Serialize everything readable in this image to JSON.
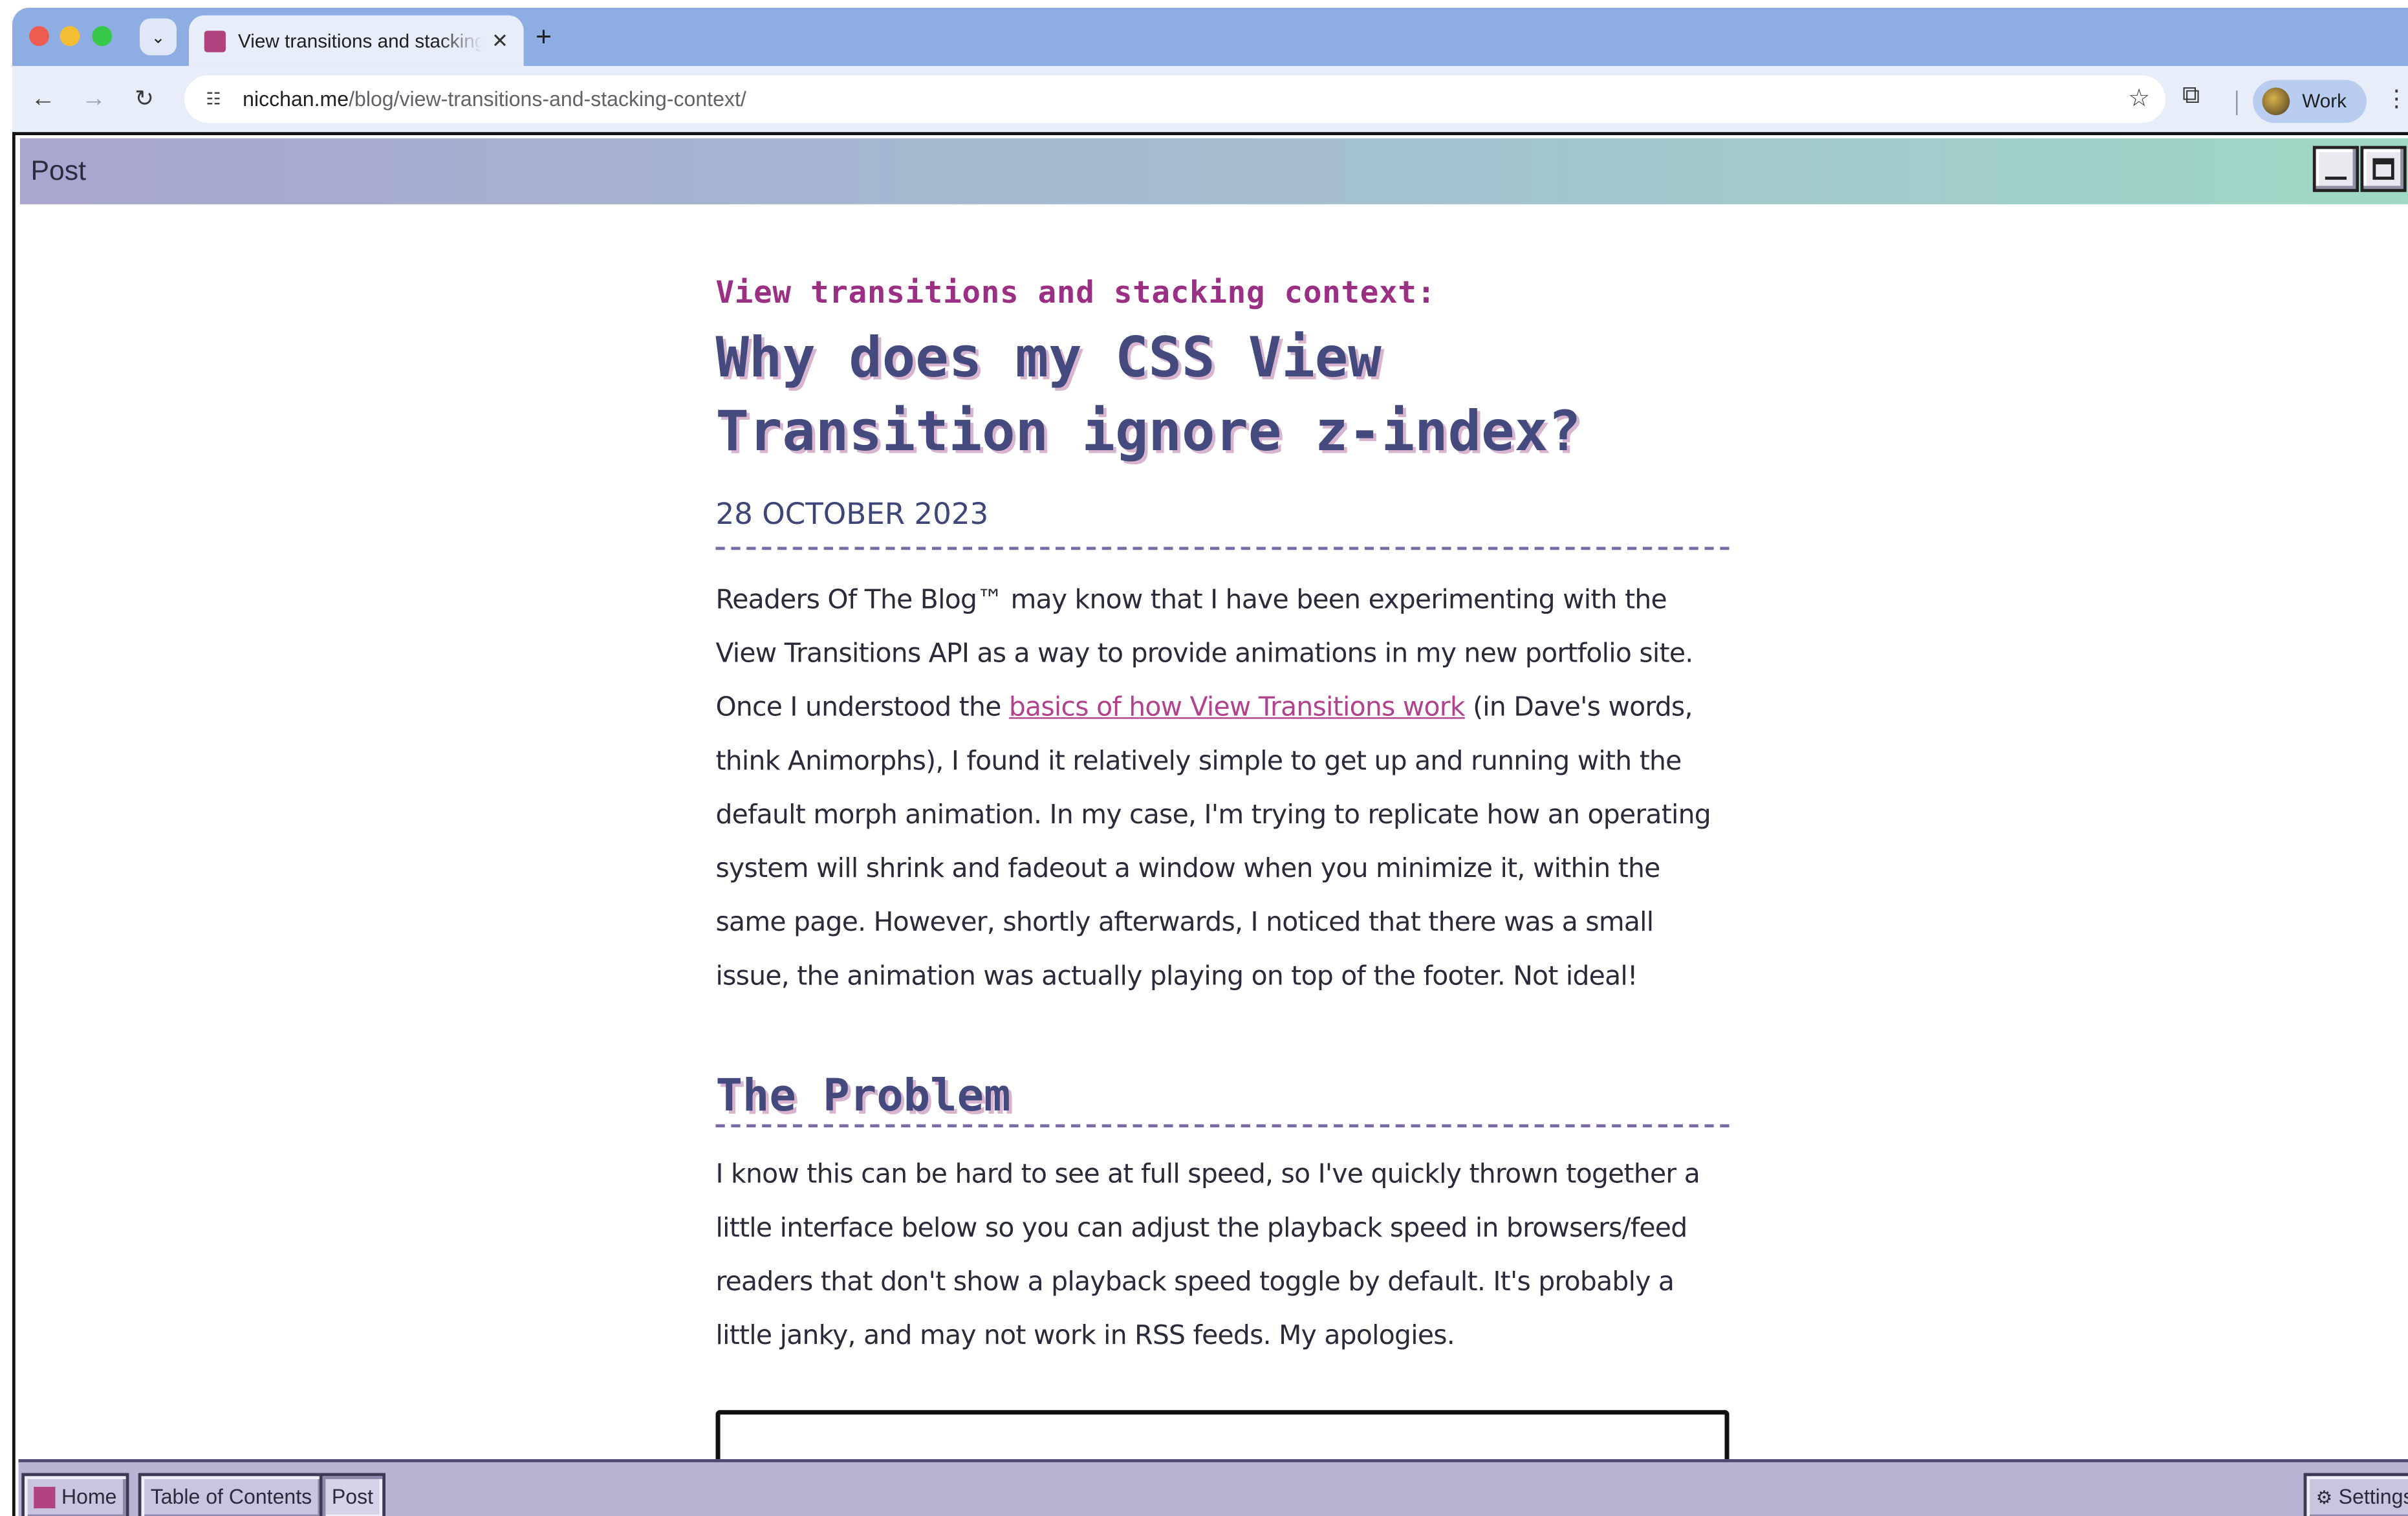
{
  "browser": {
    "tab_title": "View transitions and stacking context",
    "tab_close": "✕",
    "new_tab": "+",
    "url_host": "nicchan.me",
    "url_path": "/blog/view-transitions-and-stacking-context/",
    "profile_label": "Work"
  },
  "window": {
    "title": "Post"
  },
  "article": {
    "kicker": "View transitions and stacking context:",
    "title": "Why does my CSS View Transition ignore z-index?",
    "date": "28 OCTOBER 2023",
    "para1_before": "Readers Of The Blog™ may know that I have been experimenting with the View Transitions API as a way to provide animations in my new portfolio site. Once I understood the ",
    "para1_link": "basics of how View Transitions work",
    "para1_after": " (in Dave's words, think Animorphs), I found it relatively simple to get up and running with the default morph animation. In my case, I'm trying to replicate how an operating system will shrink and fadeout a window when you minimize it, within the same page. However, shortly afterwards, I noticed that there was a small issue, the animation was actually playing on top of the footer. Not ideal!",
    "section_heading": "The Problem",
    "para2": "I know this can be hard to see at full speed, so I've quickly thrown together a little interface below so you can adjust the playback speed in browsers/feed readers that don't show a playback speed toggle by default. It's probably a little janky, and may not work in RSS feeds. My apologies."
  },
  "taskbar": {
    "home_label": "Home",
    "toc_label": "Table of Contents",
    "post_label": "Post",
    "settings_label": "Settings"
  },
  "icons": {
    "back": "back-arrow-icon",
    "forward": "forward-arrow-icon",
    "reload": "reload-icon",
    "star": "bookmark-star-icon",
    "extensions": "extensions-icon",
    "menu": "kebab-menu-icon",
    "settings": "gear-icon"
  },
  "colors": {
    "accent_pink": "#9b2f84",
    "heading_indigo": "#444a7e",
    "link": "#b0428e",
    "tabbar_blue": "#8eaee3",
    "taskbar": "#b9b4d4"
  }
}
